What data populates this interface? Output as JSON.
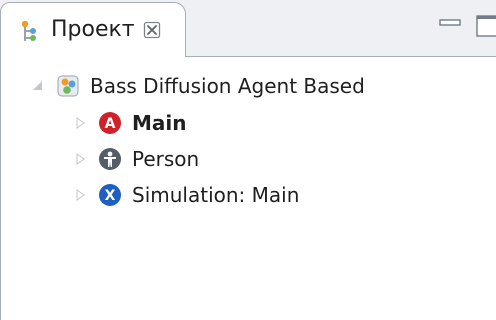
{
  "view": {
    "title": "Проект",
    "tab_icon": "project-icon",
    "close_icon": "close-icon",
    "minimize_icon": "minimize-icon",
    "maximize_icon": "maximize-icon"
  },
  "tree": {
    "root": {
      "label": "Bass Diffusion Agent Based",
      "icon": "model-icon",
      "expanded": true,
      "children": [
        {
          "label": "Main",
          "icon": "active-object-icon",
          "icon_letter": "A",
          "bold": true,
          "expanded": false
        },
        {
          "label": "Person",
          "icon": "agent-person-icon",
          "bold": false,
          "expanded": false
        },
        {
          "label": "Simulation: Main",
          "icon": "experiment-icon",
          "icon_letter": "X",
          "bold": false,
          "expanded": false
        }
      ]
    }
  },
  "colors": {
    "accent_red": "#d0212b",
    "accent_blue": "#1f5fbf",
    "person_gray": "#555d66",
    "border": "#a7aeb9"
  }
}
